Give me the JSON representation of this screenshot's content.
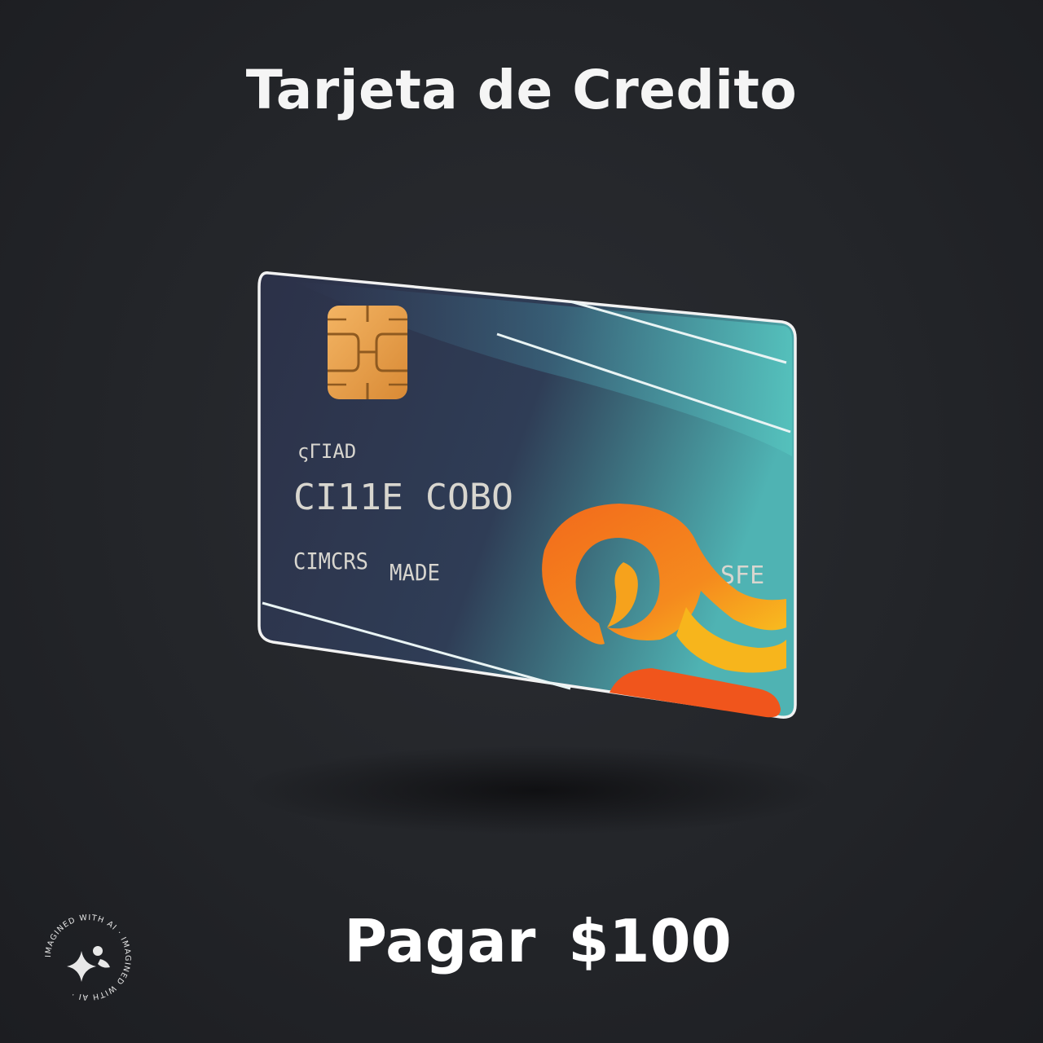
{
  "header": {
    "title": "Tarjeta de Credito"
  },
  "card": {
    "small_label": "ςΓΙΑD",
    "number_text": "CI11E COΒO",
    "holder_left": "CIMCRS",
    "holder_right": "MADE",
    "brand_text": "SFE",
    "colors": {
      "card_base": "#2a2f45",
      "card_teal": "#4fb3b3",
      "chip": "#e9a24a",
      "logo_orange": "#f26a1b",
      "logo_yellow": "#f7b51c"
    }
  },
  "action": {
    "pay_label": "Pagar",
    "amount": "$100"
  },
  "watermark": {
    "ring_text": "IMAGINED WITH AI · IMAGINED WITH AI ·"
  }
}
